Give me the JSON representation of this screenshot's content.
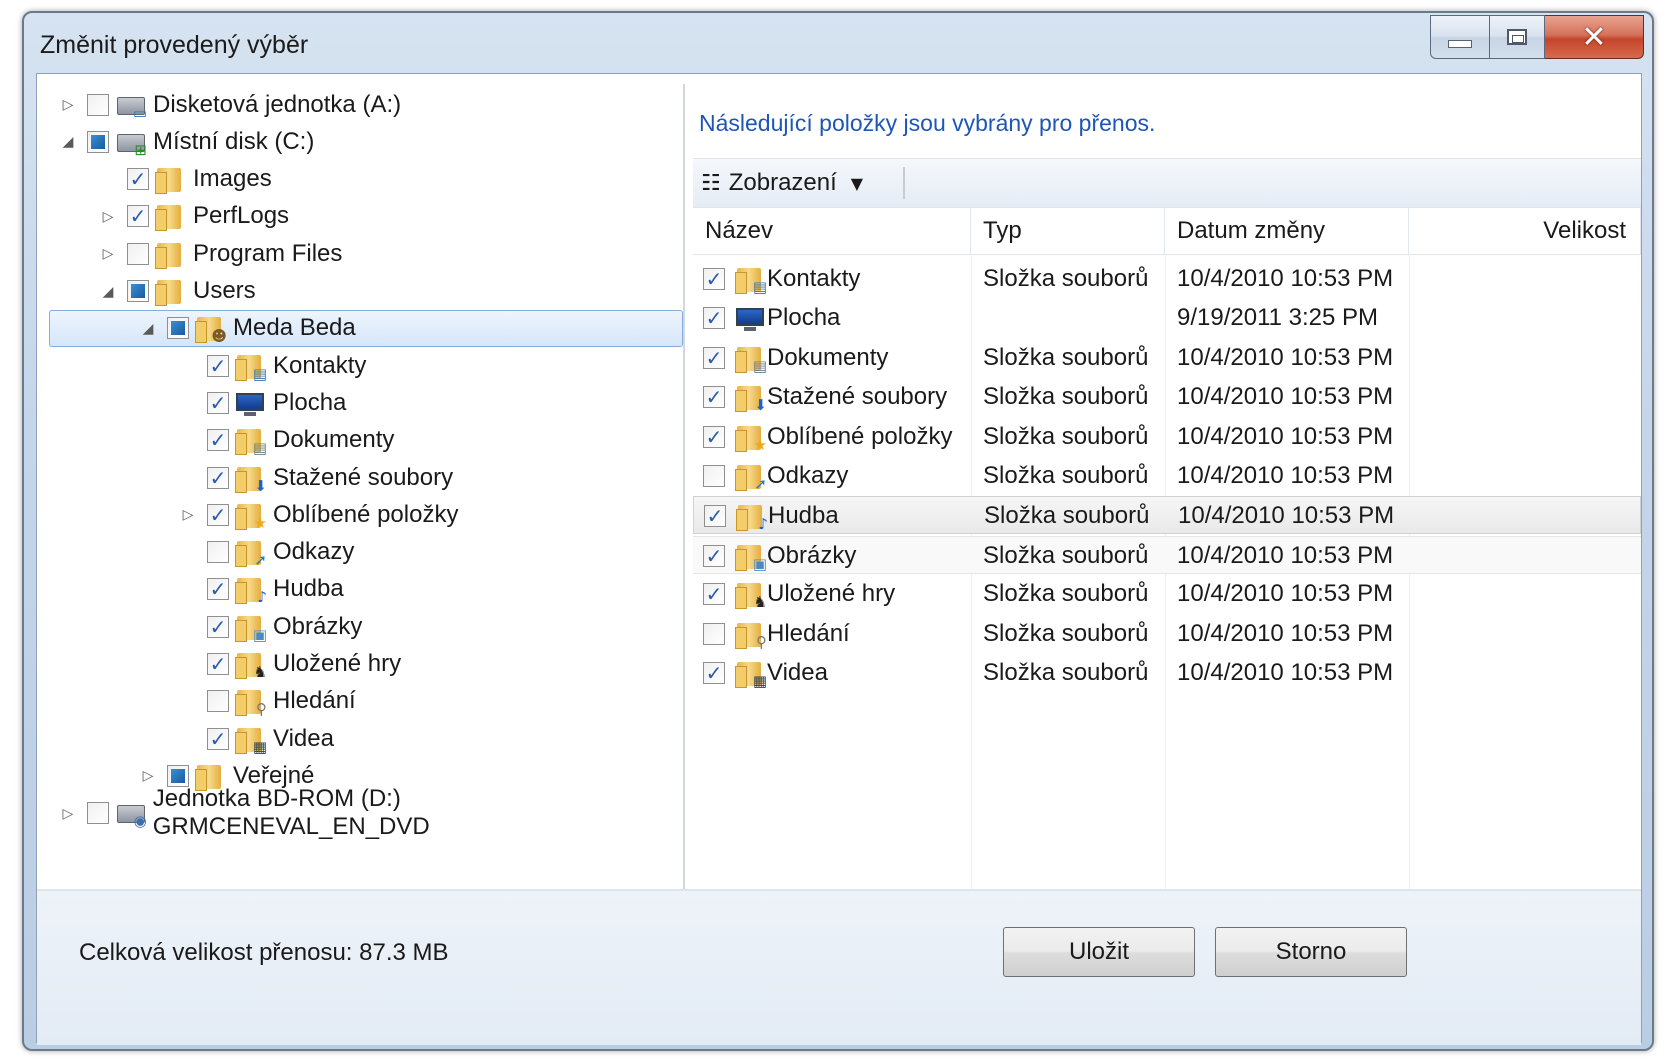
{
  "window": {
    "title": "Změnit provedený výběr"
  },
  "tree": [
    {
      "label": "Disketová jednotka (A:)",
      "expander": "closed",
      "check": "empty",
      "icon": "floppy-drive-icon",
      "level": 0
    },
    {
      "label": "Místní disk (C:)",
      "expander": "open",
      "check": "partial",
      "icon": "local-disk-icon",
      "level": 0
    },
    {
      "label": "Images",
      "expander": "none",
      "check": "checked",
      "icon": "folder-icon",
      "level": 1
    },
    {
      "label": "PerfLogs",
      "expander": "closed",
      "check": "checked",
      "icon": "folder-icon",
      "level": 1
    },
    {
      "label": "Program Files",
      "expander": "closed",
      "check": "empty",
      "icon": "folder-icon",
      "level": 1
    },
    {
      "label": "Users",
      "expander": "open",
      "check": "partial",
      "icon": "folder-icon",
      "level": 1
    },
    {
      "label": "Meda Beda",
      "expander": "open",
      "check": "partial",
      "icon": "user-folder-icon",
      "level": 2,
      "selected": true
    },
    {
      "label": "Kontakty",
      "expander": "none",
      "check": "checked",
      "icon": "contacts-folder-icon",
      "level": 3
    },
    {
      "label": "Plocha",
      "expander": "none",
      "check": "checked",
      "icon": "desktop-folder-icon",
      "level": 3
    },
    {
      "label": "Dokumenty",
      "expander": "none",
      "check": "checked",
      "icon": "documents-folder-icon",
      "level": 3
    },
    {
      "label": "Stažené soubory",
      "expander": "none",
      "check": "checked",
      "icon": "downloads-folder-icon",
      "level": 3
    },
    {
      "label": "Oblíbené položky",
      "expander": "closed",
      "check": "checked",
      "icon": "favorites-folder-icon",
      "level": 3
    },
    {
      "label": "Odkazy",
      "expander": "none",
      "check": "empty",
      "icon": "links-folder-icon",
      "level": 3
    },
    {
      "label": "Hudba",
      "expander": "none",
      "check": "checked",
      "icon": "music-folder-icon",
      "level": 3
    },
    {
      "label": "Obrázky",
      "expander": "none",
      "check": "checked",
      "icon": "pictures-folder-icon",
      "level": 3
    },
    {
      "label": "Uložené hry",
      "expander": "none",
      "check": "checked",
      "icon": "saved-games-folder-icon",
      "level": 3
    },
    {
      "label": "Hledání",
      "expander": "none",
      "check": "empty",
      "icon": "searches-folder-icon",
      "level": 3
    },
    {
      "label": "Videa",
      "expander": "none",
      "check": "checked",
      "icon": "videos-folder-icon",
      "level": 3
    },
    {
      "label": "Veřejné",
      "expander": "closed",
      "check": "partial",
      "icon": "folder-icon",
      "level": 2
    },
    {
      "label": "Jednotka BD-ROM (D:) GRMCENEVAL_EN_DVD",
      "expander": "closed",
      "check": "empty",
      "icon": "optical-drive-icon",
      "level": 0
    }
  ],
  "details": {
    "info": "Následující položky jsou vybrány pro přenos.",
    "view_label": "Zobrazení",
    "columns": [
      "Název",
      "Typ",
      "Datum změny",
      "Velikost"
    ],
    "rows": [
      {
        "name": "Kontakty",
        "type": "Složka souborů",
        "date": "10/4/2010 10:53 PM",
        "checked": true,
        "icon": "contacts-folder-icon"
      },
      {
        "name": "Plocha",
        "type": "",
        "date": "9/19/2011 3:25 PM",
        "checked": true,
        "icon": "desktop-folder-icon"
      },
      {
        "name": "Dokumenty",
        "type": "Složka souborů",
        "date": "10/4/2010 10:53 PM",
        "checked": true,
        "icon": "documents-folder-icon"
      },
      {
        "name": "Stažené soubory",
        "type": "Složka souborů",
        "date": "10/4/2010 10:53 PM",
        "checked": true,
        "icon": "downloads-folder-icon"
      },
      {
        "name": "Oblíbené položky",
        "type": "Složka souborů",
        "date": "10/4/2010 10:53 PM",
        "checked": true,
        "icon": "favorites-folder-icon"
      },
      {
        "name": "Odkazy",
        "type": "Složka souborů",
        "date": "10/4/2010 10:53 PM",
        "checked": false,
        "icon": "links-folder-icon"
      },
      {
        "name": "Hudba",
        "type": "Složka souborů",
        "date": "10/4/2010 10:53 PM",
        "checked": true,
        "icon": "music-folder-icon",
        "state": "hover"
      },
      {
        "name": "Obrázky",
        "type": "Složka souborů",
        "date": "10/4/2010 10:53 PM",
        "checked": true,
        "icon": "pictures-folder-icon",
        "state": "hover2"
      },
      {
        "name": "Uložené hry",
        "type": "Složka souborů",
        "date": "10/4/2010 10:53 PM",
        "checked": true,
        "icon": "saved-games-folder-icon"
      },
      {
        "name": "Hledání",
        "type": "Složka souborů",
        "date": "10/4/2010 10:53 PM",
        "checked": false,
        "icon": "searches-folder-icon"
      },
      {
        "name": "Videa",
        "type": "Složka souborů",
        "date": "10/4/2010 10:53 PM",
        "checked": true,
        "icon": "videos-folder-icon"
      }
    ]
  },
  "footer": {
    "total": "Celková velikost přenosu: 87.3 MB",
    "save_label": "Uložit",
    "cancel_label": "Storno"
  },
  "colors": {
    "info_text": "#1e56b8",
    "selection": "#d5e6fa",
    "checkbox_check": "#2b5aa8",
    "partial_fill": "#1a5aa0"
  }
}
